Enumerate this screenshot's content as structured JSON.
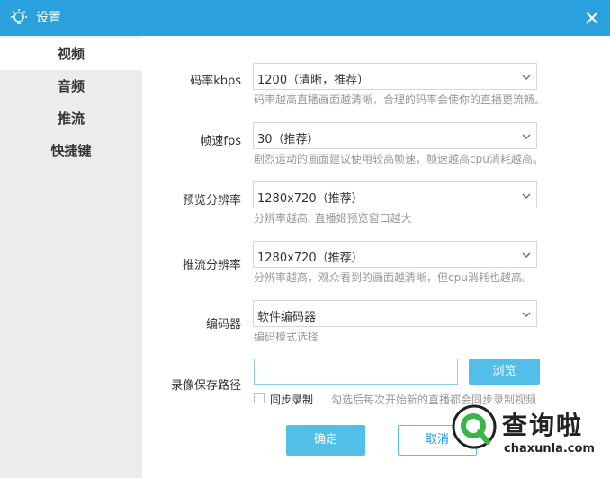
{
  "window": {
    "title": "设置",
    "icon": "lightbulb-icon",
    "close_icon": "close-icon",
    "accent": "#2aa0dc"
  },
  "sidebar": {
    "items": [
      {
        "label": "视频",
        "active": true
      },
      {
        "label": "音频",
        "active": false
      },
      {
        "label": "推流",
        "active": false
      },
      {
        "label": "快捷键",
        "active": false
      }
    ]
  },
  "settings": {
    "bitrate": {
      "label": "码率kbps",
      "value": "1200（清晰，推荐）",
      "hint": "码率越高直播画面越清晰，合理的码率会使你的直播更流畅。"
    },
    "fps": {
      "label": "帧速fps",
      "value": "30（推荐）",
      "hint": "剧烈运动的画面建议使用较高帧速，帧速越高cpu消耗越高。"
    },
    "preview_res": {
      "label": "预览分辨率",
      "value": "1280x720（推荐）",
      "hint": "分辨率越高, 直播姬预览窗口越大"
    },
    "stream_res": {
      "label": "推流分辨率",
      "value": "1280x720（推荐）",
      "hint": "分辨率越高，观众看到的画面越清晰，但cpu消耗也越高。"
    },
    "encoder": {
      "label": "编码器",
      "value": "软件编码器",
      "hint": "编码模式选择"
    },
    "record": {
      "label": "录像保存路径",
      "path_value": "",
      "browse_label": "浏览",
      "sync_label": "同步录制",
      "sync_checked": false,
      "sync_hint": "勾选后每次开始新的直播都会同步录制视频"
    }
  },
  "footer": {
    "ok_label": "确定",
    "cancel_label": "取消"
  },
  "watermark": {
    "text": "查询啦",
    "url": "chaxunla.com"
  }
}
